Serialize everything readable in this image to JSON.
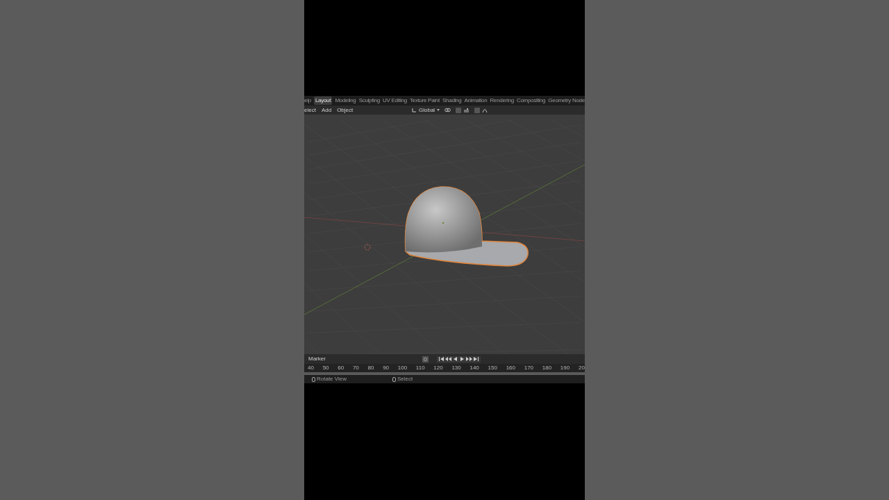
{
  "topbar": {
    "menu": "elp",
    "tabs": [
      {
        "label": "Layout",
        "selected": true
      },
      {
        "label": "Modeling",
        "selected": false
      },
      {
        "label": "Sculpting",
        "selected": false
      },
      {
        "label": "UV Editing",
        "selected": false
      },
      {
        "label": "Texture Paint",
        "selected": false
      },
      {
        "label": "Shading",
        "selected": false
      },
      {
        "label": "Animation",
        "selected": false
      },
      {
        "label": "Rendering",
        "selected": false
      },
      {
        "label": "Compositing",
        "selected": false
      },
      {
        "label": "Geometry Node",
        "selected": false
      }
    ]
  },
  "header": {
    "menus": [
      "elect",
      "Add",
      "Object"
    ],
    "orientation": "Global"
  },
  "timeline": {
    "menu": "Marker",
    "ruler": [
      "40",
      "50",
      "60",
      "70",
      "80",
      "90",
      "100",
      "110",
      "120",
      "130",
      "140",
      "150",
      "160",
      "170",
      "180",
      "190",
      "20"
    ]
  },
  "status_bar": [
    "Rotate View",
    "Select"
  ]
}
